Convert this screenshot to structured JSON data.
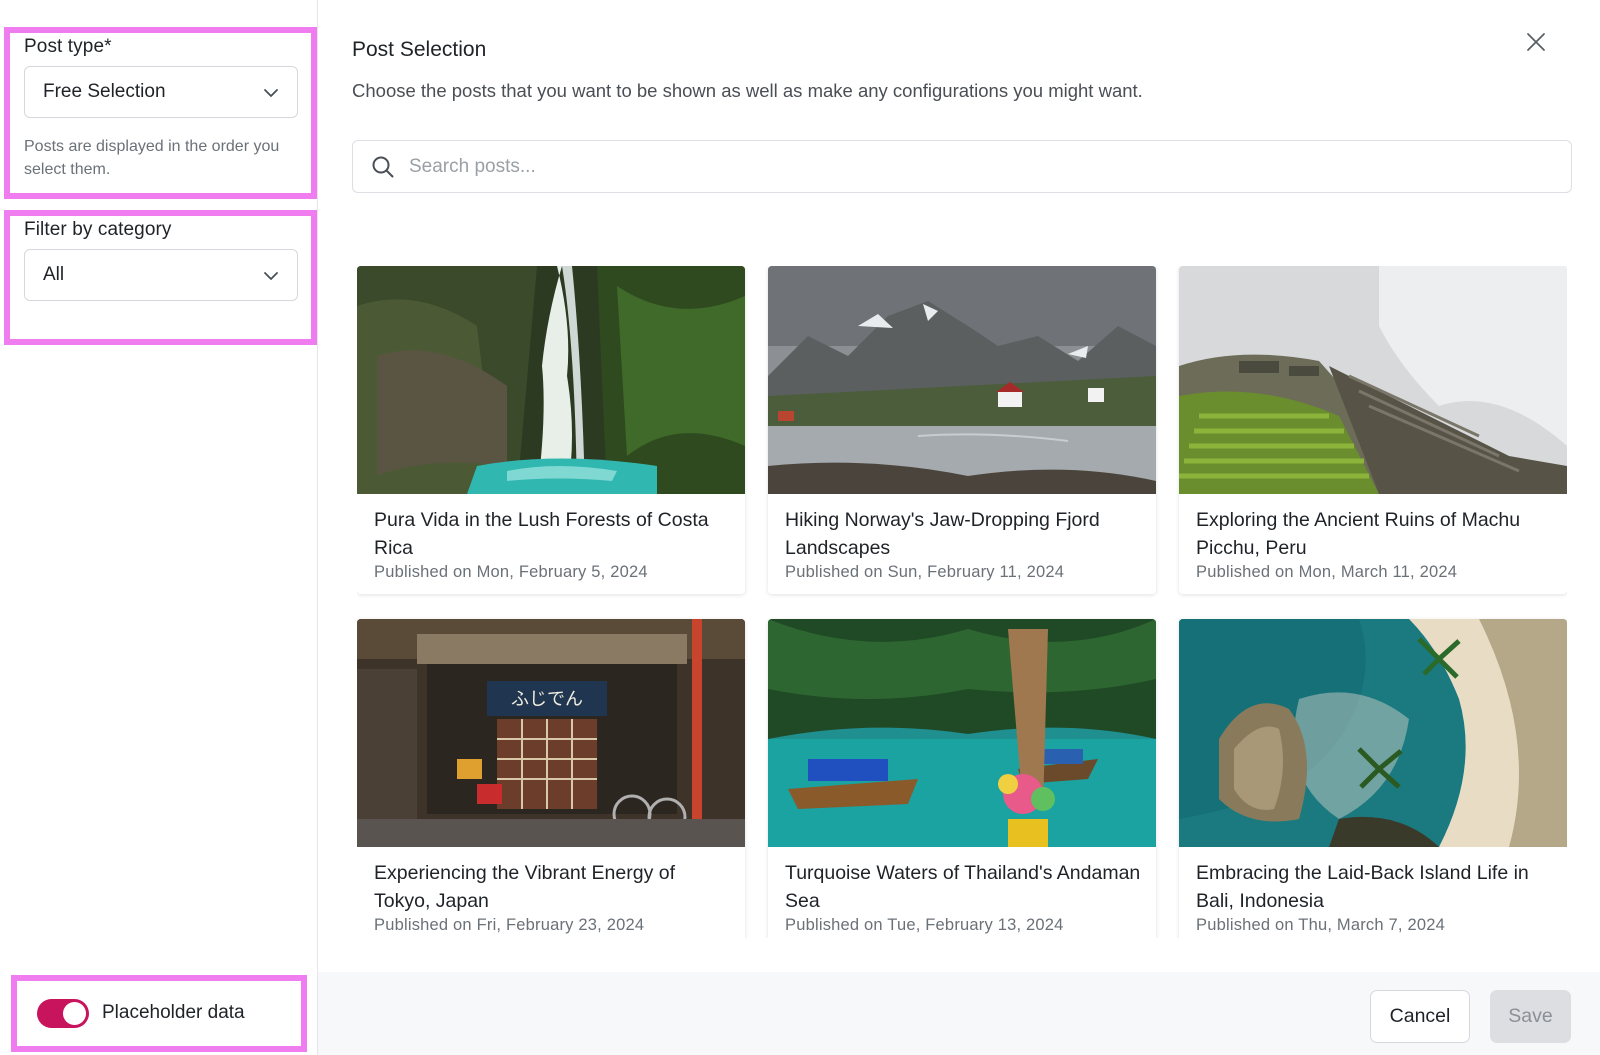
{
  "sidebar": {
    "post_type": {
      "label": "Post type*",
      "value": "Free Selection",
      "helper": "Posts are displayed in the order you select them."
    },
    "filter": {
      "label": "Filter by category",
      "value": "All"
    },
    "placeholder_toggle": {
      "label": "Placeholder data",
      "on": true
    }
  },
  "main": {
    "title": "Post Selection",
    "subtitle": "Choose the posts that you want to be shown as well as make any configurations you might want.",
    "search": {
      "placeholder": "Search posts..."
    },
    "posts": [
      {
        "title": "Pura Vida in the Lush Forests of Costa Rica",
        "date": "Published on Mon, February 5, 2024",
        "image": "waterfall"
      },
      {
        "title": "Hiking Norway's Jaw-Dropping Fjord Landscapes",
        "date": "Published on Sun, February 11, 2024",
        "image": "fjord"
      },
      {
        "title": "Exploring the Ancient Ruins of Machu Picchu, Peru",
        "date": "Published on Mon, March 11, 2024",
        "image": "ruins"
      },
      {
        "title": "Experiencing the Vibrant Energy of Tokyo, Japan",
        "date": "Published on Fri, February 23, 2024",
        "image": "tokyo-shop"
      },
      {
        "title": "Turquoise Waters of Thailand's Andaman Sea",
        "date": "Published on Tue, February 13, 2024",
        "image": "longtail-boat"
      },
      {
        "title": "Embracing the Laid-Back Island Life in Bali, Indonesia",
        "date": "Published on Thu, March 7, 2024",
        "image": "bali-coast"
      }
    ]
  },
  "footer": {
    "cancel_label": "Cancel",
    "save_label": "Save"
  },
  "colors": {
    "highlight": "#f07df0",
    "toggle_on": "#c8145c"
  }
}
